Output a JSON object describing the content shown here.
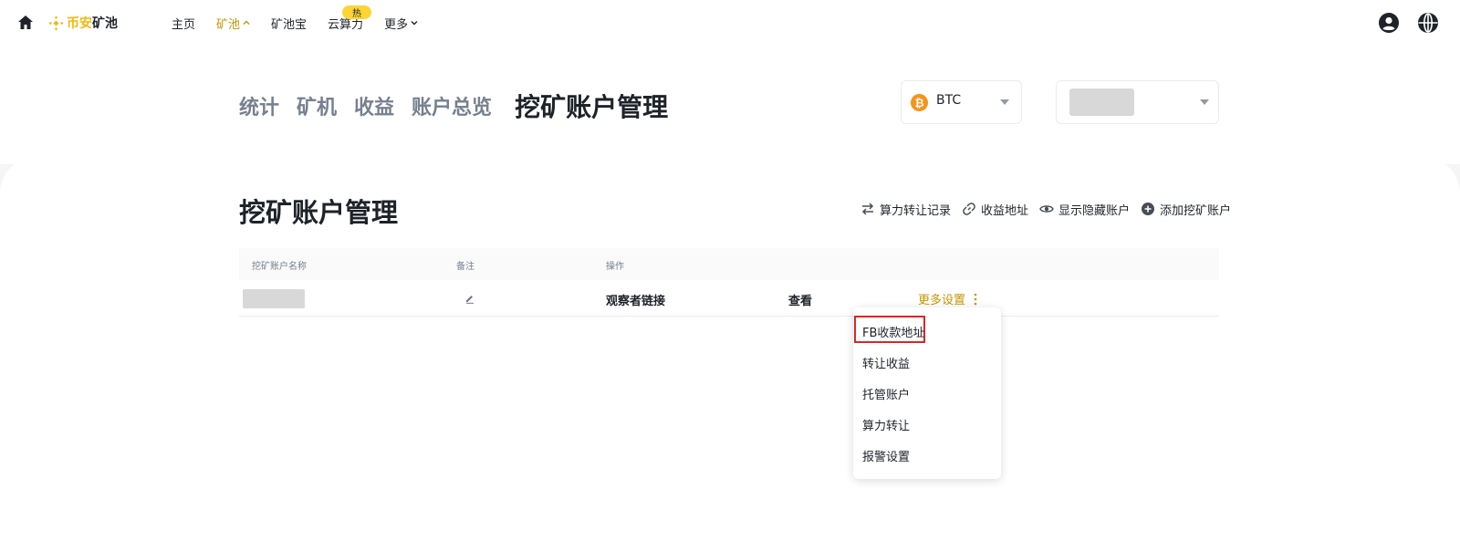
{
  "header": {
    "logo_text_brand": "币安",
    "logo_text_product": "矿池",
    "nav": {
      "home": "主页",
      "pool": "矿池",
      "pool_savings": "矿池宝",
      "cloud_hashrate": "云算力",
      "more": "更多"
    },
    "hot_badge": "热",
    "icons": [
      "home-icon",
      "binance-logo-icon",
      "chevron-up-icon",
      "chevron-down-icon",
      "user-icon",
      "globe-icon"
    ]
  },
  "tabs": {
    "stats": "统计",
    "miners": "矿机",
    "earnings": "收益",
    "overview": "账户总览",
    "management": "挖矿账户管理"
  },
  "coin_select": {
    "value": "BTC",
    "icon": "bitcoin-icon"
  },
  "section": {
    "title": "挖矿账户管理",
    "actions": {
      "transfer_records": "算力转让记录",
      "payout_address": "收益地址",
      "show_hidden": "显示隐藏账户",
      "add_account": "添加挖矿账户"
    }
  },
  "table": {
    "columns": {
      "name": "挖矿账户名称",
      "remark": "备注",
      "operation": "操作"
    },
    "row": {
      "observer_link": "观察者链接",
      "view": "查看",
      "more_settings": "更多设置"
    }
  },
  "menu": {
    "items": [
      "FB收款地址",
      "转让收益",
      "托管账户",
      "算力转让",
      "报警设置"
    ],
    "highlight_color": "#e02424"
  },
  "colors": {
    "accent": "#f0b90b",
    "accent_text": "#c99400",
    "text": "#1e2329",
    "muted": "#76808f"
  }
}
